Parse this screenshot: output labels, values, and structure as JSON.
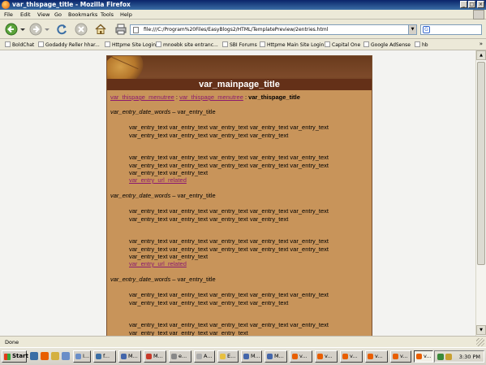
{
  "window": {
    "title": "var_thispage_title - Mozilla Firefox",
    "minimize": "_",
    "maximize": "□",
    "close": "×"
  },
  "menu": [
    "File",
    "Edit",
    "View",
    "Go",
    "Bookmarks",
    "Tools",
    "Help"
  ],
  "address": {
    "url": "file:///C:/Program%20Files/EasyBlogs2/HTML/TemplatePreview/2entries.html",
    "dropdown": "▼"
  },
  "search_box": {
    "engine_glyph": "G",
    "value": ""
  },
  "bookmarks": [
    {
      "label": "BoldChat"
    },
    {
      "label": "Godaddy Reller hhar..."
    },
    {
      "label": "Httpme Site Login"
    },
    {
      "label": "mnoebk site entranc..."
    },
    {
      "label": "SBI Forums"
    },
    {
      "label": "Httpme Main Site Login"
    },
    {
      "label": "Capital One"
    },
    {
      "label": "Google AdSense"
    },
    {
      "label": "hb"
    }
  ],
  "bookmarks_chevron": "»",
  "page": {
    "main_title": "var_mainpage_title",
    "breadcrumb": {
      "link1": "var_thispage_menutree",
      "sep1": " : ",
      "link2": "var_thispage_menutree",
      "sep2": " : ",
      "current": "var_thispage_title"
    },
    "entries": [
      {
        "date_words": "var_entry_date_words",
        "dash": " – ",
        "title": "var_entry_title",
        "para1": "var_entry_text var_entry_text var_entry_text var_entry_text var_entry_text var_entry_text var_entry_text var_entry_text var_entry_text",
        "para2": "var_entry_text var_entry_text var_entry_text var_entry_text var_entry_text var_entry_text var_entry_text var_entry_text var_entry_text var_entry_text var_entry_text var_entry_text",
        "link": "var_entry_url_related"
      },
      {
        "date_words": "var_entry_date_words",
        "dash": " – ",
        "title": "var_entry_title",
        "para1": "var_entry_text var_entry_text var_entry_text var_entry_text var_entry_text var_entry_text var_entry_text var_entry_text var_entry_text",
        "para2": "var_entry_text var_entry_text var_entry_text var_entry_text var_entry_text var_entry_text var_entry_text var_entry_text var_entry_text var_entry_text var_entry_text var_entry_text",
        "link": "var_entry_url_related"
      },
      {
        "date_words": "var_entry_date_words",
        "dash": " – ",
        "title": "var_entry_title",
        "para1": "var_entry_text var_entry_text var_entry_text var_entry_text var_entry_text var_entry_text var_entry_text var_entry_text var_entry_text",
        "para2": "var_entry_text var_entry_text var_entry_text var_entry_text var_entry_text var_entry_text var_entry_text var_entry_text"
      }
    ]
  },
  "status": {
    "text": "Done"
  },
  "taskbar": {
    "start": "Start",
    "tasks": [
      {
        "label": "I...",
        "color": "#6a8ec8"
      },
      {
        "label": "f...",
        "color": "#3a6ea5"
      },
      {
        "label": "M...",
        "color": "#4466aa"
      },
      {
        "label": "M...",
        "color": "#c83a2a"
      },
      {
        "label": "e...",
        "color": "#888888"
      },
      {
        "label": "A...",
        "color": "#aaaaaa"
      },
      {
        "label": "E...",
        "color": "#e8c040"
      },
      {
        "label": "M...",
        "color": "#4466aa"
      },
      {
        "label": "M...",
        "color": "#4466aa"
      },
      {
        "label": "v...",
        "color": "#e85e00"
      },
      {
        "label": "v...",
        "color": "#e85e00"
      },
      {
        "label": "v...",
        "color": "#e85e00"
      },
      {
        "label": "v...",
        "color": "#e85e00"
      },
      {
        "label": "v...",
        "color": "#e85e00"
      },
      {
        "label": "v...",
        "color": "#e85e00"
      }
    ],
    "clock": "3:30 PM"
  },
  "colors": {
    "page_bg": "#c8945a",
    "banner_bar": "#643018",
    "link": "#8b1a6f"
  }
}
